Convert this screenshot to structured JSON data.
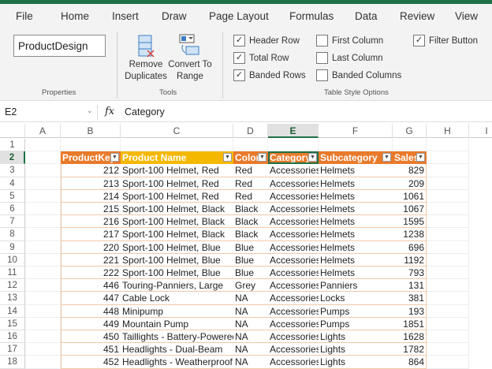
{
  "menu": [
    "File",
    "Home",
    "Insert",
    "Draw",
    "Page Layout",
    "Formulas",
    "Data",
    "Review",
    "View"
  ],
  "ribbon": {
    "table_name": "ProductDesign",
    "properties_label": "Properties",
    "remove_duplicates": [
      "Remove",
      "Duplicates"
    ],
    "convert_to_range": [
      "Convert To",
      "Range"
    ],
    "tools_label": "Tools",
    "options": [
      {
        "label": "Header Row",
        "checked": true
      },
      {
        "label": "Total Row",
        "checked": true
      },
      {
        "label": "Banded Rows",
        "checked": true
      },
      {
        "label": "First Column",
        "checked": false
      },
      {
        "label": "Last Column",
        "checked": false
      },
      {
        "label": "Banded Columns",
        "checked": false
      },
      {
        "label": "Filter Button",
        "checked": true
      }
    ],
    "table_style_options_label": "Table Style Options"
  },
  "formula_bar": {
    "cell_ref": "E2",
    "fx": "fx",
    "value": "Category"
  },
  "columns": [
    "A",
    "B",
    "C",
    "D",
    "E",
    "F",
    "G",
    "H",
    "I"
  ],
  "selected_column": "E",
  "row_numbers": [
    "1",
    "2",
    "3",
    "4",
    "5",
    "6",
    "7",
    "8",
    "9",
    "10",
    "11",
    "12",
    "13",
    "14",
    "15",
    "16",
    "17",
    "18"
  ],
  "table": {
    "headers": [
      "ProductKey",
      "Product Name",
      "Color",
      "Category",
      "Subcategory",
      "Sales"
    ],
    "rows": [
      [
        "212",
        "Sport-100 Helmet, Red",
        "Red",
        "Accessories",
        "Helmets",
        "829"
      ],
      [
        "213",
        "Sport-100 Helmet, Red",
        "Red",
        "Accessories",
        "Helmets",
        "209"
      ],
      [
        "214",
        "Sport-100 Helmet, Red",
        "Red",
        "Accessories",
        "Helmets",
        "1061"
      ],
      [
        "215",
        "Sport-100 Helmet, Black",
        "Black",
        "Accessories",
        "Helmets",
        "1067"
      ],
      [
        "216",
        "Sport-100 Helmet, Black",
        "Black",
        "Accessories",
        "Helmets",
        "1595"
      ],
      [
        "217",
        "Sport-100 Helmet, Black",
        "Black",
        "Accessories",
        "Helmets",
        "1238"
      ],
      [
        "220",
        "Sport-100 Helmet, Blue",
        "Blue",
        "Accessories",
        "Helmets",
        "696"
      ],
      [
        "221",
        "Sport-100 Helmet, Blue",
        "Blue",
        "Accessories",
        "Helmets",
        "1192"
      ],
      [
        "222",
        "Sport-100 Helmet, Blue",
        "Blue",
        "Accessories",
        "Helmets",
        "793"
      ],
      [
        "446",
        "Touring-Panniers, Large",
        "Grey",
        "Accessories",
        "Panniers",
        "131"
      ],
      [
        "447",
        "Cable Lock",
        "NA",
        "Accessories",
        "Locks",
        "381"
      ],
      [
        "448",
        "Minipump",
        "NA",
        "Accessories",
        "Pumps",
        "193"
      ],
      [
        "449",
        "Mountain Pump",
        "NA",
        "Accessories",
        "Pumps",
        "1851"
      ],
      [
        "450",
        "Taillights - Battery-Powered",
        "NA",
        "Accessories",
        "Lights",
        "1628"
      ],
      [
        "451",
        "Headlights - Dual-Beam",
        "NA",
        "Accessories",
        "Lights",
        "1782"
      ],
      [
        "452",
        "Headlights - Weatherproof",
        "NA",
        "Accessories",
        "Lights",
        "864"
      ]
    ]
  },
  "colors": {
    "accent": "#1e7145",
    "header": "#e97a2b",
    "highlight_header": "#f5b800"
  }
}
